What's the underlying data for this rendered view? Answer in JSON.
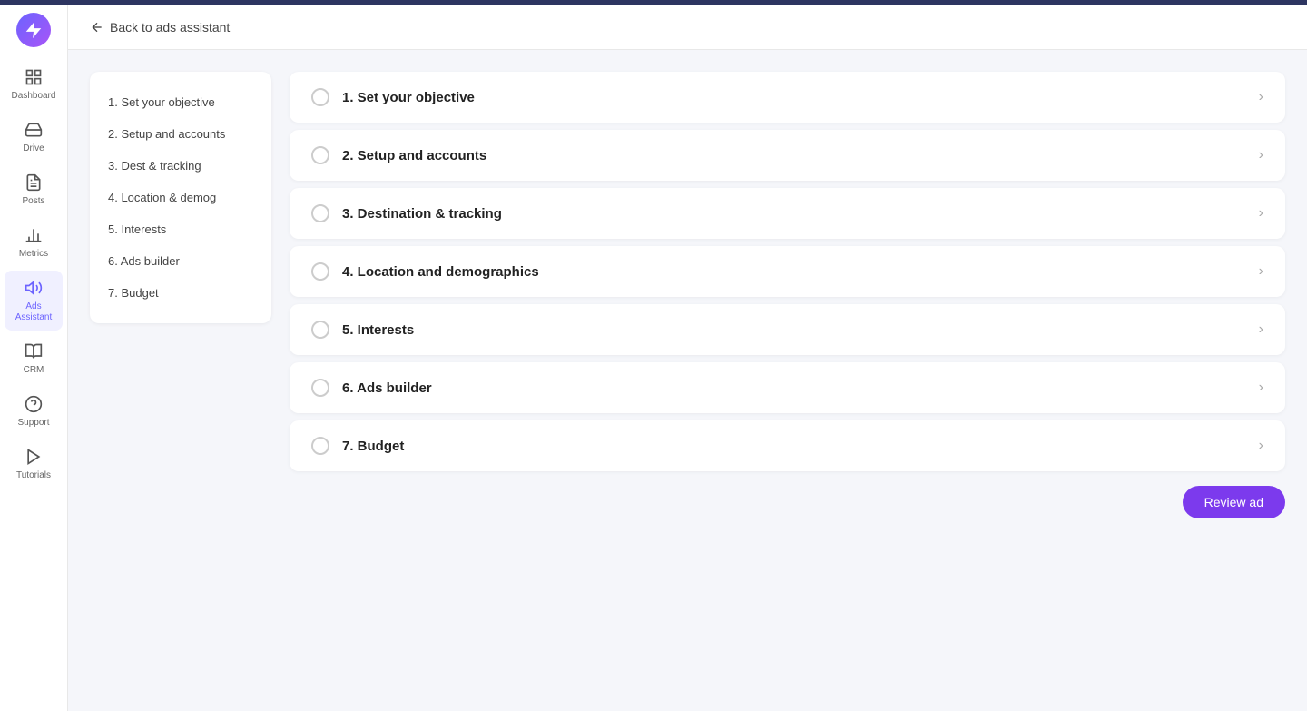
{
  "topbar": {},
  "logo": {
    "alt": "App Logo"
  },
  "sidebar": {
    "items": [
      {
        "id": "dashboard",
        "label": "Dashboard",
        "icon": "dashboard"
      },
      {
        "id": "drive",
        "label": "Drive",
        "icon": "drive"
      },
      {
        "id": "posts",
        "label": "Posts",
        "icon": "posts"
      },
      {
        "id": "metrics",
        "label": "Metrics",
        "icon": "metrics"
      },
      {
        "id": "ads-assistant",
        "label": "Ads Assistant",
        "icon": "ads",
        "active": true
      },
      {
        "id": "crm",
        "label": "CRM",
        "icon": "crm"
      },
      {
        "id": "support",
        "label": "Support",
        "icon": "support"
      },
      {
        "id": "tutorials",
        "label": "Tutorials",
        "icon": "tutorials"
      }
    ]
  },
  "header": {
    "back_label": "Back to ads assistant"
  },
  "left_panel": {
    "items": [
      {
        "id": "step1",
        "label": "1. Set your objective"
      },
      {
        "id": "step2",
        "label": "2. Setup and accounts"
      },
      {
        "id": "step3",
        "label": "3. Dest & tracking"
      },
      {
        "id": "step4",
        "label": "4. Location & demog"
      },
      {
        "id": "step5",
        "label": "5. Interests"
      },
      {
        "id": "step6",
        "label": "6. Ads builder"
      },
      {
        "id": "step7",
        "label": "7. Budget"
      }
    ]
  },
  "steps": [
    {
      "id": "s1",
      "label": "1. Set your objective"
    },
    {
      "id": "s2",
      "label": "2. Setup and accounts"
    },
    {
      "id": "s3",
      "label": "3. Destination & tracking"
    },
    {
      "id": "s4",
      "label": "4. Location and demographics"
    },
    {
      "id": "s5",
      "label": "5. Interests"
    },
    {
      "id": "s6",
      "label": "6. Ads builder"
    },
    {
      "id": "s7",
      "label": "7. Budget"
    }
  ],
  "review_btn": {
    "label": "Review ad"
  }
}
